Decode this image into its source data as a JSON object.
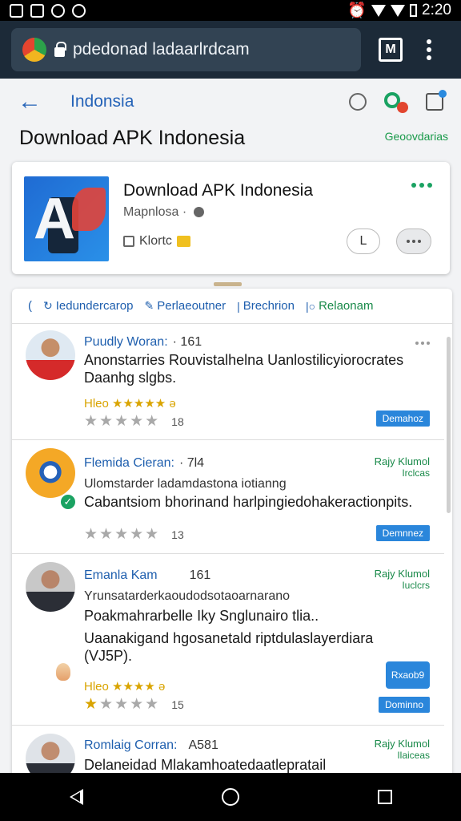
{
  "statusbar": {
    "time": "2:20"
  },
  "browser": {
    "url": "pdedonad ladaarlrdcam",
    "tab_glyph": "M"
  },
  "header": {
    "back_label": "←",
    "breadcrumb": "Indonsia"
  },
  "page": {
    "title": "Download APK Indonesia",
    "top_link": "Geoovdarias"
  },
  "app": {
    "name": "Download APK Indonesia",
    "developer": "Mapnlosa ·",
    "meta": "Klortc",
    "button_label": "L"
  },
  "filters": [
    {
      "label": "("
    },
    {
      "label": "Iedundercarop",
      "icon": "↻"
    },
    {
      "label": "Perlaeoutner",
      "icon": "✎"
    },
    {
      "label": "Brechrion",
      "icon": "|"
    },
    {
      "label": "Relaonam",
      "icon": "|○"
    }
  ],
  "reviews": [
    {
      "name": "Puudly Woran:",
      "count": "· 161",
      "text1": "Anonstarries Rouvistalhelna Uanlostilicyiorocrates",
      "text2": "Daanhg slgbs.",
      "gold": "Hleo ★★★★★ ə",
      "stars_on": 0,
      "rating_count": "18",
      "button": "Demahoz"
    },
    {
      "name": "Flemida Cieran:",
      "count": "· 7l4",
      "sub": "Ulomstarder ladamdastona iotianng",
      "text1": "Cabantsiom bhorinand harlpingiedohakeractionpits.",
      "tag_top": "Rajy Klumol",
      "tag_bottom": "Irclcas",
      "stars_on": 0,
      "rating_count": "13",
      "button": "Demnnez"
    },
    {
      "name": "Emanla Kam",
      "count": "161",
      "sub": "Yrunsatarderkaoudodsotaoarnarano",
      "text1": "Poakmahrarbelle Iky Snglunairo tlia..",
      "text2": "Uaanakigand hgosanetald riptdulaslayerdiara",
      "text3": "(VJ5P).",
      "gold": "Hleo ★★★★ ə",
      "tag_top": "Rajy Klumol",
      "tag_bottom": "Iuclcrs",
      "stars_on": 1,
      "rating_count": "15",
      "button_big": "Rxaob9",
      "button": "Dominno"
    },
    {
      "name": "Romlaig Corran:",
      "count": "A581",
      "text1": "Delaneidad Mlakamhoatedaatlepratail",
      "tag_top": "Rajy Klumol",
      "tag_bottom": "Ilaiceas"
    }
  ]
}
